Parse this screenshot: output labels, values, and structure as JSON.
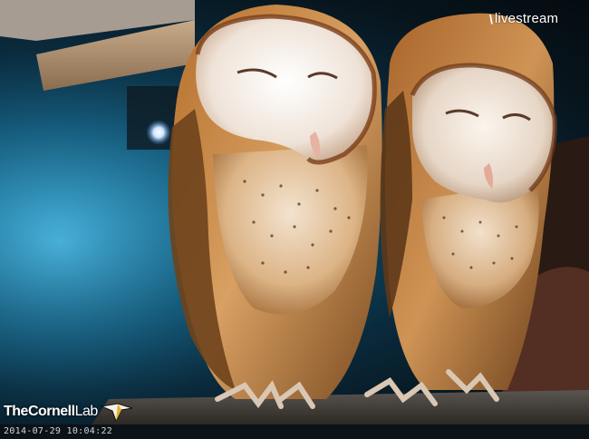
{
  "overlay": {
    "brand_mark": "\\",
    "brand_word": "livestream",
    "org_name_bold_part1": "The",
    "org_name_bold_part2": "Cornell",
    "org_name_thin": "Lab",
    "timestamp": "2014-07-29 10:04:22"
  },
  "colors": {
    "nest_box_glow": "#2a8fb8",
    "owl_plumage": "#c8893e",
    "owl_face": "#f1e6dc",
    "wood_ledge": "#9c7b5b"
  }
}
